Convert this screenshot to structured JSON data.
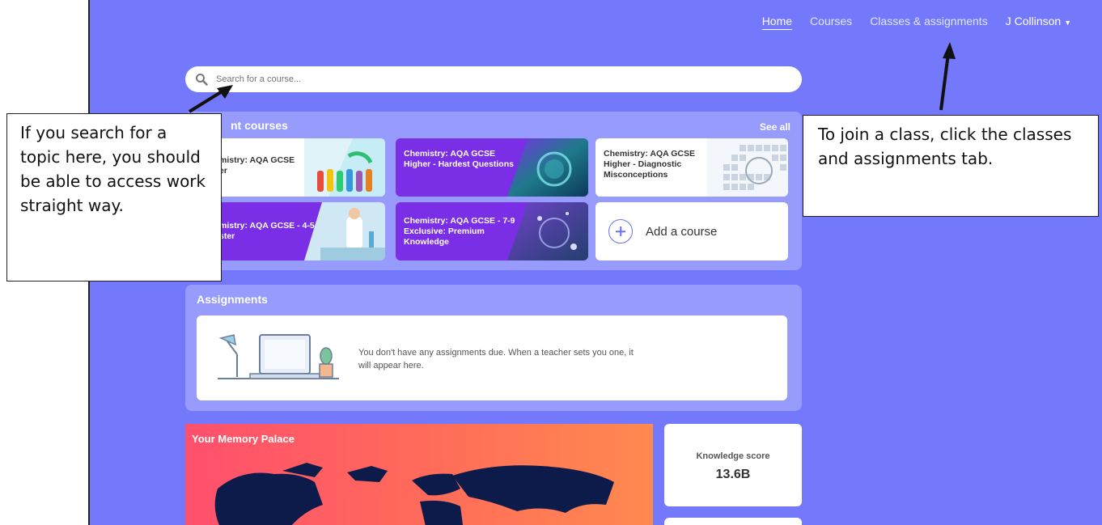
{
  "nav": {
    "home": "Home",
    "courses": "Courses",
    "classes": "Classes & assignments",
    "user": "J Collinson"
  },
  "search": {
    "placeholder": "Search for a course..."
  },
  "recent": {
    "title": "nt courses",
    "see_all": "See all",
    "cards": [
      {
        "title": "mistry: AQA GCSE\ner"
      },
      {
        "title": "Chemistry: AQA GCSE Higher - Hardest Questions"
      },
      {
        "title": "Chemistry: AQA GCSE Higher - Diagnostic Misconceptions"
      },
      {
        "title": "mistry: AQA GCSE - 4-5\nster"
      },
      {
        "title": "Chemistry: AQA GCSE - 7-9 Exclusive: Premium Knowledge"
      }
    ],
    "add_label": "Add a course"
  },
  "assignments": {
    "title": "Assignments",
    "empty_text": "You don't have any assignments due. When a teacher sets you one, it will appear here."
  },
  "memory": {
    "title": "Your Memory Palace"
  },
  "knowledge": {
    "label": "Knowledge score",
    "value": "13.6B"
  },
  "callouts": {
    "left": "If you search for a topic here, you should be able to access work straight way.",
    "right": "To join a class, click the classes and assignments tab."
  },
  "colors": {
    "background": "#7479fb",
    "panel": "#979bfb",
    "purple_card": "#7a2fe6",
    "memory_start": "#ff4f6d",
    "memory_end": "#ff8a4f"
  }
}
